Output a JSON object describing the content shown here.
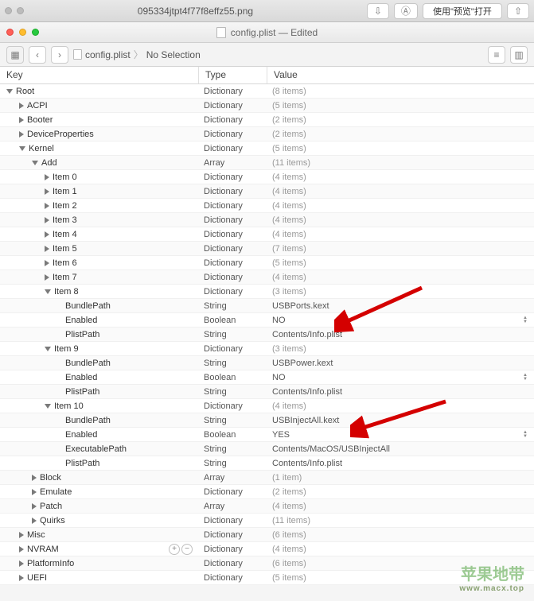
{
  "tab": {
    "filename": "095334jtpt4f77f8effz55.png",
    "open_label": "使用\"预览\"打开"
  },
  "window": {
    "title": "config.plist — Edited"
  },
  "breadcrumb": {
    "file": "config.plist",
    "selection": "No Selection"
  },
  "columns": {
    "key": "Key",
    "type": "Type",
    "value": "Value"
  },
  "rows": [
    {
      "indent": 0,
      "arrow": "down",
      "key": "Root",
      "type": "Dictionary",
      "value": "(8 items)",
      "gray": true
    },
    {
      "indent": 1,
      "arrow": "right",
      "key": "ACPI",
      "type": "Dictionary",
      "value": "(5 items)",
      "gray": true
    },
    {
      "indent": 1,
      "arrow": "right",
      "key": "Booter",
      "type": "Dictionary",
      "value": "(2 items)",
      "gray": true
    },
    {
      "indent": 1,
      "arrow": "right",
      "key": "DeviceProperties",
      "type": "Dictionary",
      "value": "(2 items)",
      "gray": true
    },
    {
      "indent": 1,
      "arrow": "down",
      "key": "Kernel",
      "type": "Dictionary",
      "value": "(5 items)",
      "gray": true
    },
    {
      "indent": 2,
      "arrow": "down",
      "key": "Add",
      "type": "Array",
      "value": "(11 items)",
      "gray": true
    },
    {
      "indent": 3,
      "arrow": "right",
      "key": "Item 0",
      "type": "Dictionary",
      "value": "(4 items)",
      "gray": true
    },
    {
      "indent": 3,
      "arrow": "right",
      "key": "Item 1",
      "type": "Dictionary",
      "value": "(4 items)",
      "gray": true
    },
    {
      "indent": 3,
      "arrow": "right",
      "key": "Item 2",
      "type": "Dictionary",
      "value": "(4 items)",
      "gray": true
    },
    {
      "indent": 3,
      "arrow": "right",
      "key": "Item 3",
      "type": "Dictionary",
      "value": "(4 items)",
      "gray": true
    },
    {
      "indent": 3,
      "arrow": "right",
      "key": "Item 4",
      "type": "Dictionary",
      "value": "(4 items)",
      "gray": true
    },
    {
      "indent": 3,
      "arrow": "right",
      "key": "Item 5",
      "type": "Dictionary",
      "value": "(7 items)",
      "gray": true
    },
    {
      "indent": 3,
      "arrow": "right",
      "key": "Item 6",
      "type": "Dictionary",
      "value": "(5 items)",
      "gray": true
    },
    {
      "indent": 3,
      "arrow": "right",
      "key": "Item 7",
      "type": "Dictionary",
      "value": "(4 items)",
      "gray": true
    },
    {
      "indent": 3,
      "arrow": "down",
      "key": "Item 8",
      "type": "Dictionary",
      "value": "(3 items)",
      "gray": true
    },
    {
      "indent": 4,
      "arrow": "none",
      "key": "BundlePath",
      "type": "String",
      "value": "USBPorts.kext",
      "gray": false
    },
    {
      "indent": 4,
      "arrow": "none",
      "key": "Enabled",
      "type": "Boolean",
      "value": "NO",
      "gray": false,
      "stepper": true
    },
    {
      "indent": 4,
      "arrow": "none",
      "key": "PlistPath",
      "type": "String",
      "value": "Contents/Info.plist",
      "gray": false
    },
    {
      "indent": 3,
      "arrow": "down",
      "key": "Item 9",
      "type": "Dictionary",
      "value": "(3 items)",
      "gray": true
    },
    {
      "indent": 4,
      "arrow": "none",
      "key": "BundlePath",
      "type": "String",
      "value": "USBPower.kext",
      "gray": false
    },
    {
      "indent": 4,
      "arrow": "none",
      "key": "Enabled",
      "type": "Boolean",
      "value": "NO",
      "gray": false,
      "stepper": true
    },
    {
      "indent": 4,
      "arrow": "none",
      "key": "PlistPath",
      "type": "String",
      "value": "Contents/Info.plist",
      "gray": false
    },
    {
      "indent": 3,
      "arrow": "down",
      "key": "Item 10",
      "type": "Dictionary",
      "value": "(4 items)",
      "gray": true
    },
    {
      "indent": 4,
      "arrow": "none",
      "key": "BundlePath",
      "type": "String",
      "value": "USBInjectAll.kext",
      "gray": false
    },
    {
      "indent": 4,
      "arrow": "none",
      "key": "Enabled",
      "type": "Boolean",
      "value": "YES",
      "gray": false,
      "stepper": true
    },
    {
      "indent": 4,
      "arrow": "none",
      "key": "ExecutablePath",
      "type": "String",
      "value": "Contents/MacOS/USBInjectAll",
      "gray": false
    },
    {
      "indent": 4,
      "arrow": "none",
      "key": "PlistPath",
      "type": "String",
      "value": "Contents/Info.plist",
      "gray": false
    },
    {
      "indent": 2,
      "arrow": "right",
      "key": "Block",
      "type": "Array",
      "value": "(1 item)",
      "gray": true
    },
    {
      "indent": 2,
      "arrow": "right",
      "key": "Emulate",
      "type": "Dictionary",
      "value": "(2 items)",
      "gray": true
    },
    {
      "indent": 2,
      "arrow": "right",
      "key": "Patch",
      "type": "Array",
      "value": "(4 items)",
      "gray": true
    },
    {
      "indent": 2,
      "arrow": "right",
      "key": "Quirks",
      "type": "Dictionary",
      "value": "(11 items)",
      "gray": true
    },
    {
      "indent": 1,
      "arrow": "right",
      "key": "Misc",
      "type": "Dictionary",
      "value": "(6 items)",
      "gray": true
    },
    {
      "indent": 1,
      "arrow": "right",
      "key": "NVRAM",
      "type": "Dictionary",
      "value": "(4 items)",
      "gray": true,
      "addremove": true
    },
    {
      "indent": 1,
      "arrow": "right",
      "key": "PlatformInfo",
      "type": "Dictionary",
      "value": "(6 items)",
      "gray": true
    },
    {
      "indent": 1,
      "arrow": "right",
      "key": "UEFI",
      "type": "Dictionary",
      "value": "(5 items)",
      "gray": true
    }
  ],
  "watermark": {
    "main": "苹果地带",
    "sub": "www.macx.top"
  }
}
